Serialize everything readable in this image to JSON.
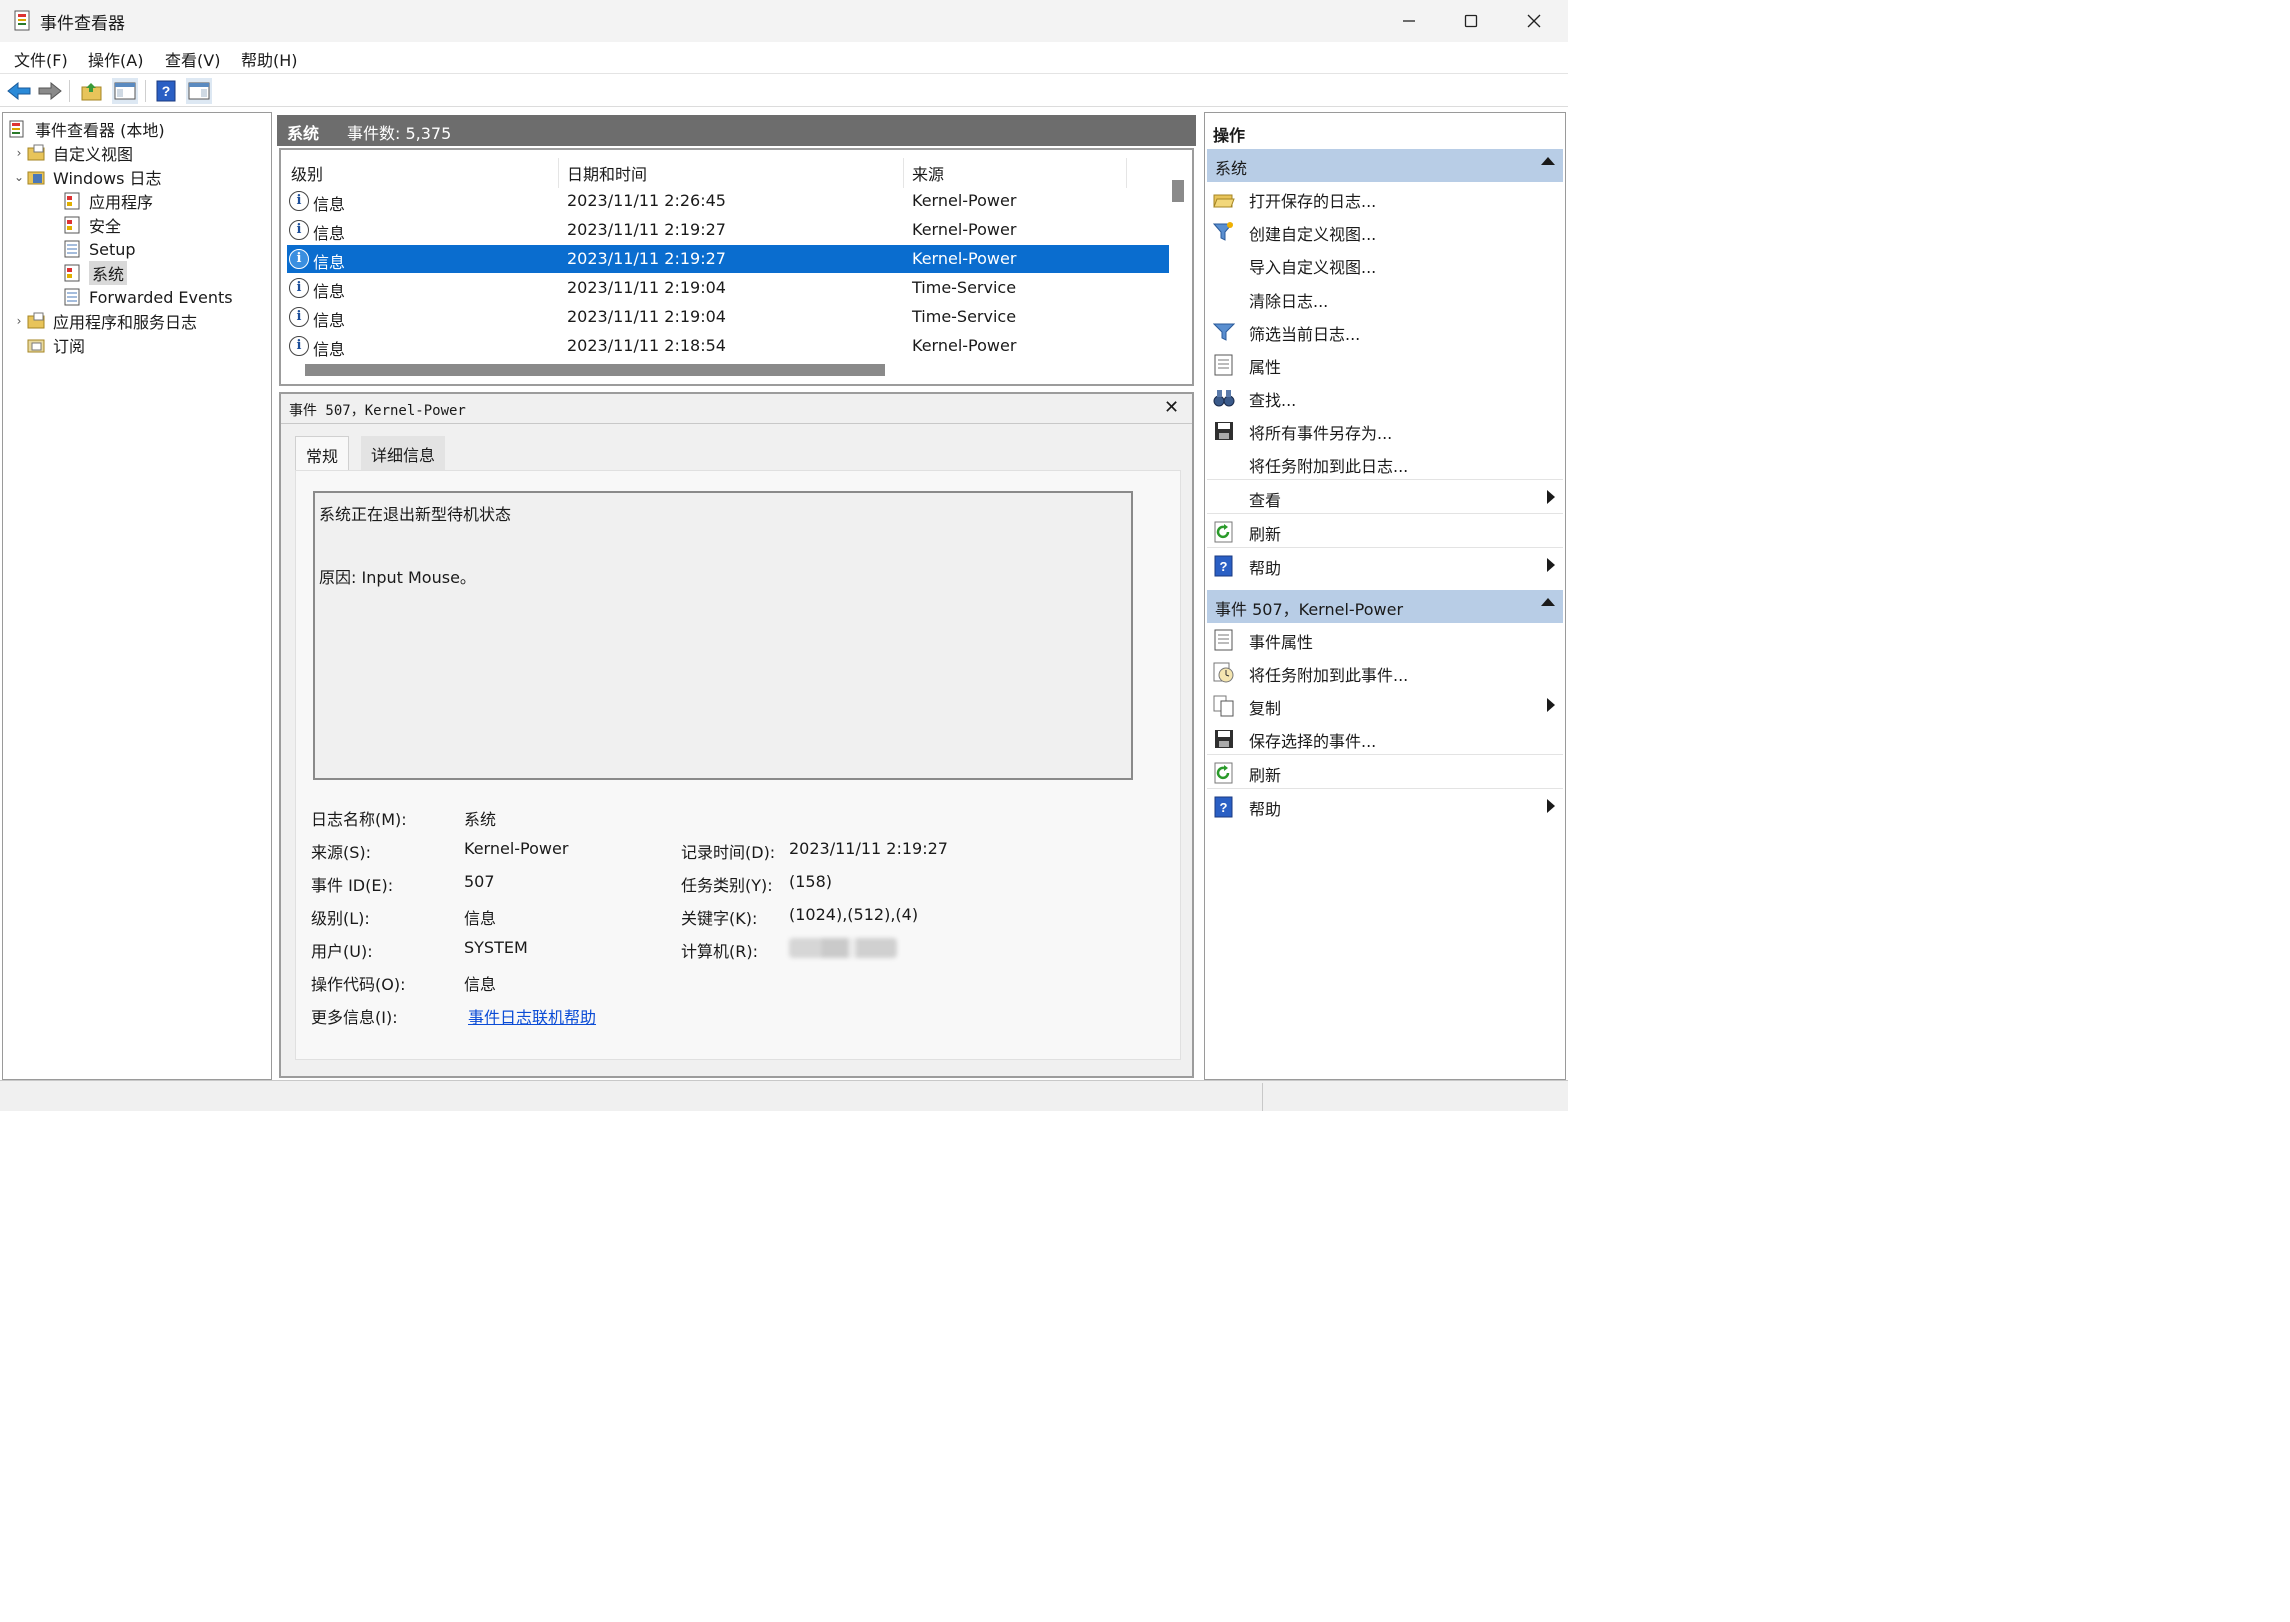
{
  "window": {
    "title": "事件查看器"
  },
  "menu": [
    "文件(F)",
    "操作(A)",
    "查看(V)",
    "帮助(H)"
  ],
  "tree": {
    "root": "事件查看器 (本地)",
    "custom_views": "自定义视图",
    "windows_logs": "Windows 日志",
    "windows_children": [
      "应用程序",
      "安全",
      "Setup",
      "系统",
      "Forwarded Events"
    ],
    "app_service_logs": "应用程序和服务日志",
    "subscriptions": "订阅"
  },
  "log": {
    "name": "系统",
    "event_count_label": "事件数: 5,375"
  },
  "list": {
    "headers": [
      "级别",
      "日期和时间",
      "来源"
    ],
    "rows": [
      {
        "level": "信息",
        "datetime": "2023/11/11 2:26:45",
        "source": "Kernel-Power"
      },
      {
        "level": "信息",
        "datetime": "2023/11/11 2:19:27",
        "source": "Kernel-Power"
      },
      {
        "level": "信息",
        "datetime": "2023/11/11 2:19:27",
        "source": "Kernel-Power"
      },
      {
        "level": "信息",
        "datetime": "2023/11/11 2:19:04",
        "source": "Time-Service"
      },
      {
        "level": "信息",
        "datetime": "2023/11/11 2:19:04",
        "source": "Time-Service"
      },
      {
        "level": "信息",
        "datetime": "2023/11/11 2:18:54",
        "source": "Kernel-Power"
      }
    ]
  },
  "detail": {
    "title": "事件 507，Kernel-Power",
    "tabs": [
      "常规",
      "详细信息"
    ],
    "message_line1": "系统正在退出新型待机状态",
    "message_line2": "原因: Input Mouse。",
    "log_name_label": "日志名称(M):",
    "log_name_value": "系统",
    "source_label": "来源(S):",
    "source_value": "Kernel-Power",
    "logged_label": "记录时间(D):",
    "logged_value": "2023/11/11 2:19:27",
    "event_id_label": "事件 ID(E):",
    "event_id_value": "507",
    "task_label": "任务类别(Y):",
    "task_value": "(158)",
    "level_label": "级别(L):",
    "level_value": "信息",
    "keywords_label": "关键字(K):",
    "keywords_value": "(1024),(512),(4)",
    "user_label": "用户(U):",
    "user_value": "SYSTEM",
    "computer_label": "计算机(R):",
    "opcode_label": "操作代码(O):",
    "opcode_value": "信息",
    "more_info_label": "更多信息(I):",
    "more_info_link": "事件日志联机帮助"
  },
  "actions": {
    "header": "操作",
    "section1": "系统",
    "section1_items": [
      "打开保存的日志...",
      "创建自定义视图...",
      "导入自定义视图...",
      "清除日志...",
      "筛选当前日志...",
      "属性",
      "查找...",
      "将所有事件另存为...",
      "将任务附加到此日志...",
      "查看",
      "刷新",
      "帮助"
    ],
    "section2": "事件 507，Kernel-Power",
    "section2_items": [
      "事件属性",
      "将任务附加到此事件...",
      "复制",
      "保存选择的事件...",
      "刷新",
      "帮助"
    ]
  },
  "colors": {
    "selection": "#0a6dcf",
    "section_header": "#b8cde6",
    "link": "#0b4cd6",
    "log_header": "#6d6d6d"
  }
}
